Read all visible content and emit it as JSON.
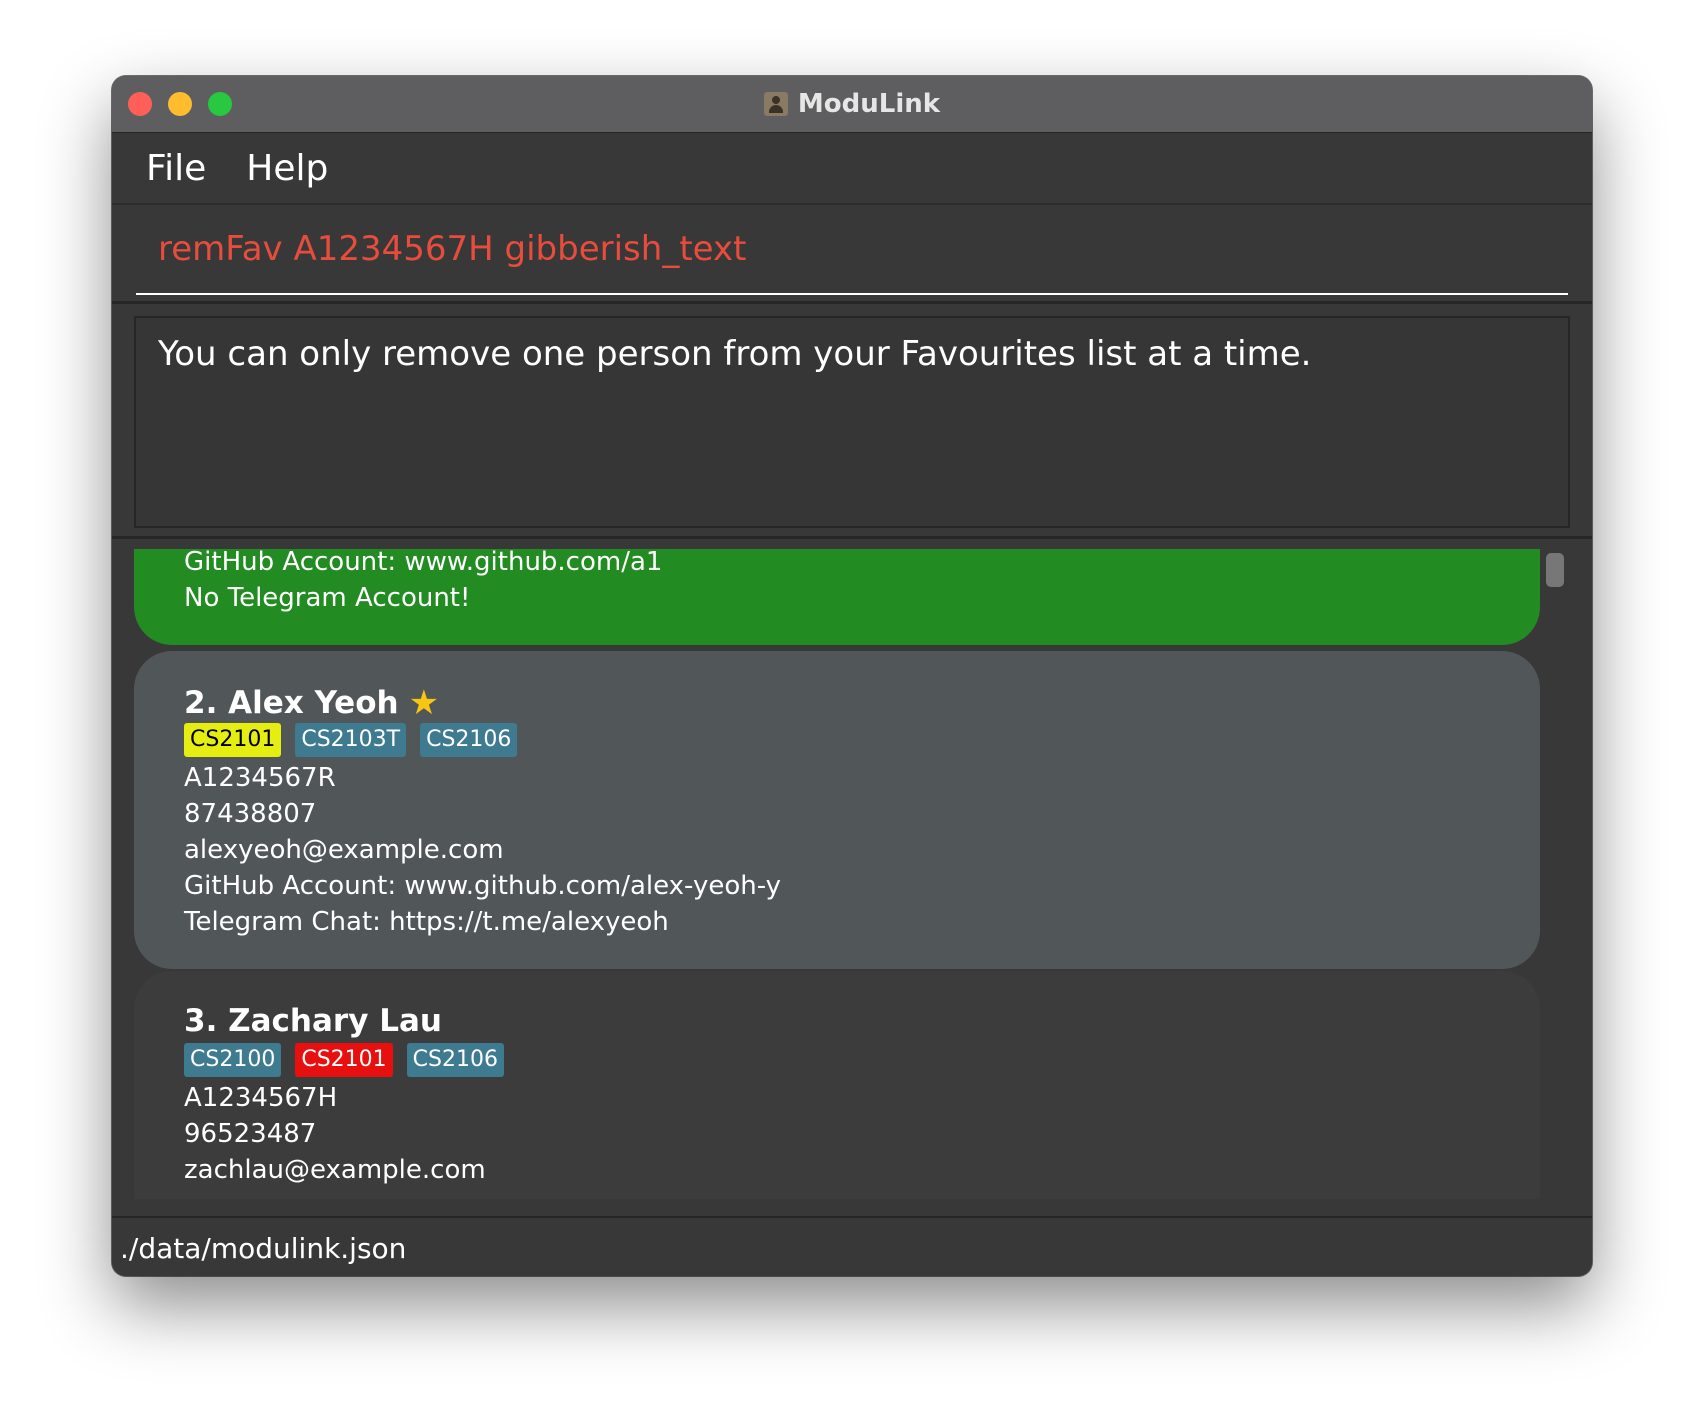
{
  "window": {
    "title": "ModuLink"
  },
  "menu": {
    "items": [
      "File",
      "Help"
    ]
  },
  "command": {
    "value": "remFav A1234567H gibberish_text"
  },
  "result": {
    "message": "You can only remove one person from your Favourites list at a time."
  },
  "persons": [
    {
      "github": "GitHub Account: www.github.com/a1",
      "telegram": "No Telegram Account!"
    },
    {
      "name": "2. Alex Yeoh",
      "favourite": true,
      "tags": [
        "CS2101",
        "CS2103T",
        "CS2106"
      ],
      "id": "A1234567R",
      "phone": "87438807",
      "email": "alexyeoh@example.com",
      "github": "GitHub Account: www.github.com/alex-yeoh-y",
      "telegram": "Telegram Chat: https://t.me/alexyeoh"
    },
    {
      "name": "3. Zachary Lau",
      "favourite": false,
      "tags": [
        "CS2100",
        "CS2101",
        "CS2106"
      ],
      "id": "A1234567H",
      "phone": "96523487",
      "email": "zachlau@example.com"
    }
  ],
  "status": {
    "path": "./data/modulink.json"
  },
  "colors": {
    "selected_card": "#228b22",
    "card": "#515658",
    "tag_default": "#3e7b91",
    "tag_yellow": "#e5ed11",
    "tag_red": "#e80f0f",
    "command_text": "#e74c3c",
    "favourite_star": "#f9c513"
  },
  "icons": {
    "favourite": "star-icon",
    "app": "contact-book-icon"
  }
}
